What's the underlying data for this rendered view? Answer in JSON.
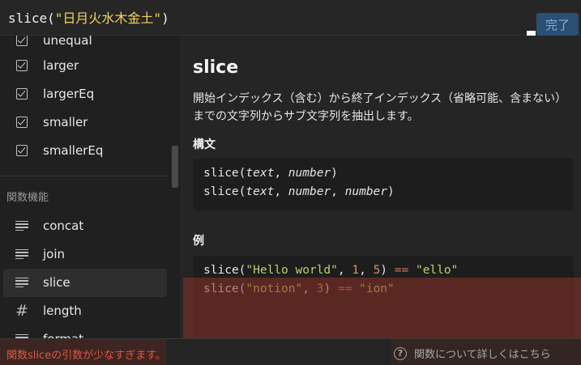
{
  "formula_bar": {
    "fn": "slice(",
    "arg": "\"日月火水木金土\"",
    "close": ")",
    "done_label": "完了"
  },
  "function_list": {
    "partial_top_label": "unequal",
    "checked_items": [
      "larger",
      "largerEq",
      "smaller",
      "smallerEq"
    ],
    "section_header": "関数機能",
    "function_items": [
      {
        "label": "concat",
        "icon": "lines-icon"
      },
      {
        "label": "join",
        "icon": "lines-icon"
      },
      {
        "label": "slice",
        "icon": "lines-icon",
        "selected": true
      },
      {
        "label": "length",
        "icon": "hash-icon"
      },
      {
        "label": "format",
        "icon": "lines-icon"
      }
    ]
  },
  "doc": {
    "title": "slice",
    "description": "開始インデックス（含む）から終了インデックス（省略可能、含まない）までの文字列からサブ文字列を抽出します。",
    "syntax_heading": "構文",
    "examples_heading": "例",
    "syntax_line1": {
      "fn": "slice(",
      "a1": "text",
      "sep": ", ",
      "a2": "number",
      "close": ")"
    },
    "syntax_line2": {
      "fn": "slice(",
      "a1": "text",
      "sep": ", ",
      "a2": "number",
      "sep2": ", ",
      "a3": "number",
      "close": ")"
    },
    "example1": {
      "fn": "slice(",
      "s": "\"Hello world\"",
      "c1": ", ",
      "n1": "1",
      "c2": ", ",
      "n2": "5",
      "close": ") ",
      "op": "==",
      "sp": " ",
      "res": "\"ello\""
    },
    "example2": {
      "fn": "slice(",
      "s": "\"notion\"",
      "c1": ", ",
      "n1": "3",
      "close": ") ",
      "op": "==",
      "sp": " ",
      "res": "\"ion\""
    }
  },
  "status": {
    "error": "関数sliceの引数が少なすぎます。",
    "learn_more": "関数について詳しくはこちら",
    "help_icon_glyph": "?"
  }
}
